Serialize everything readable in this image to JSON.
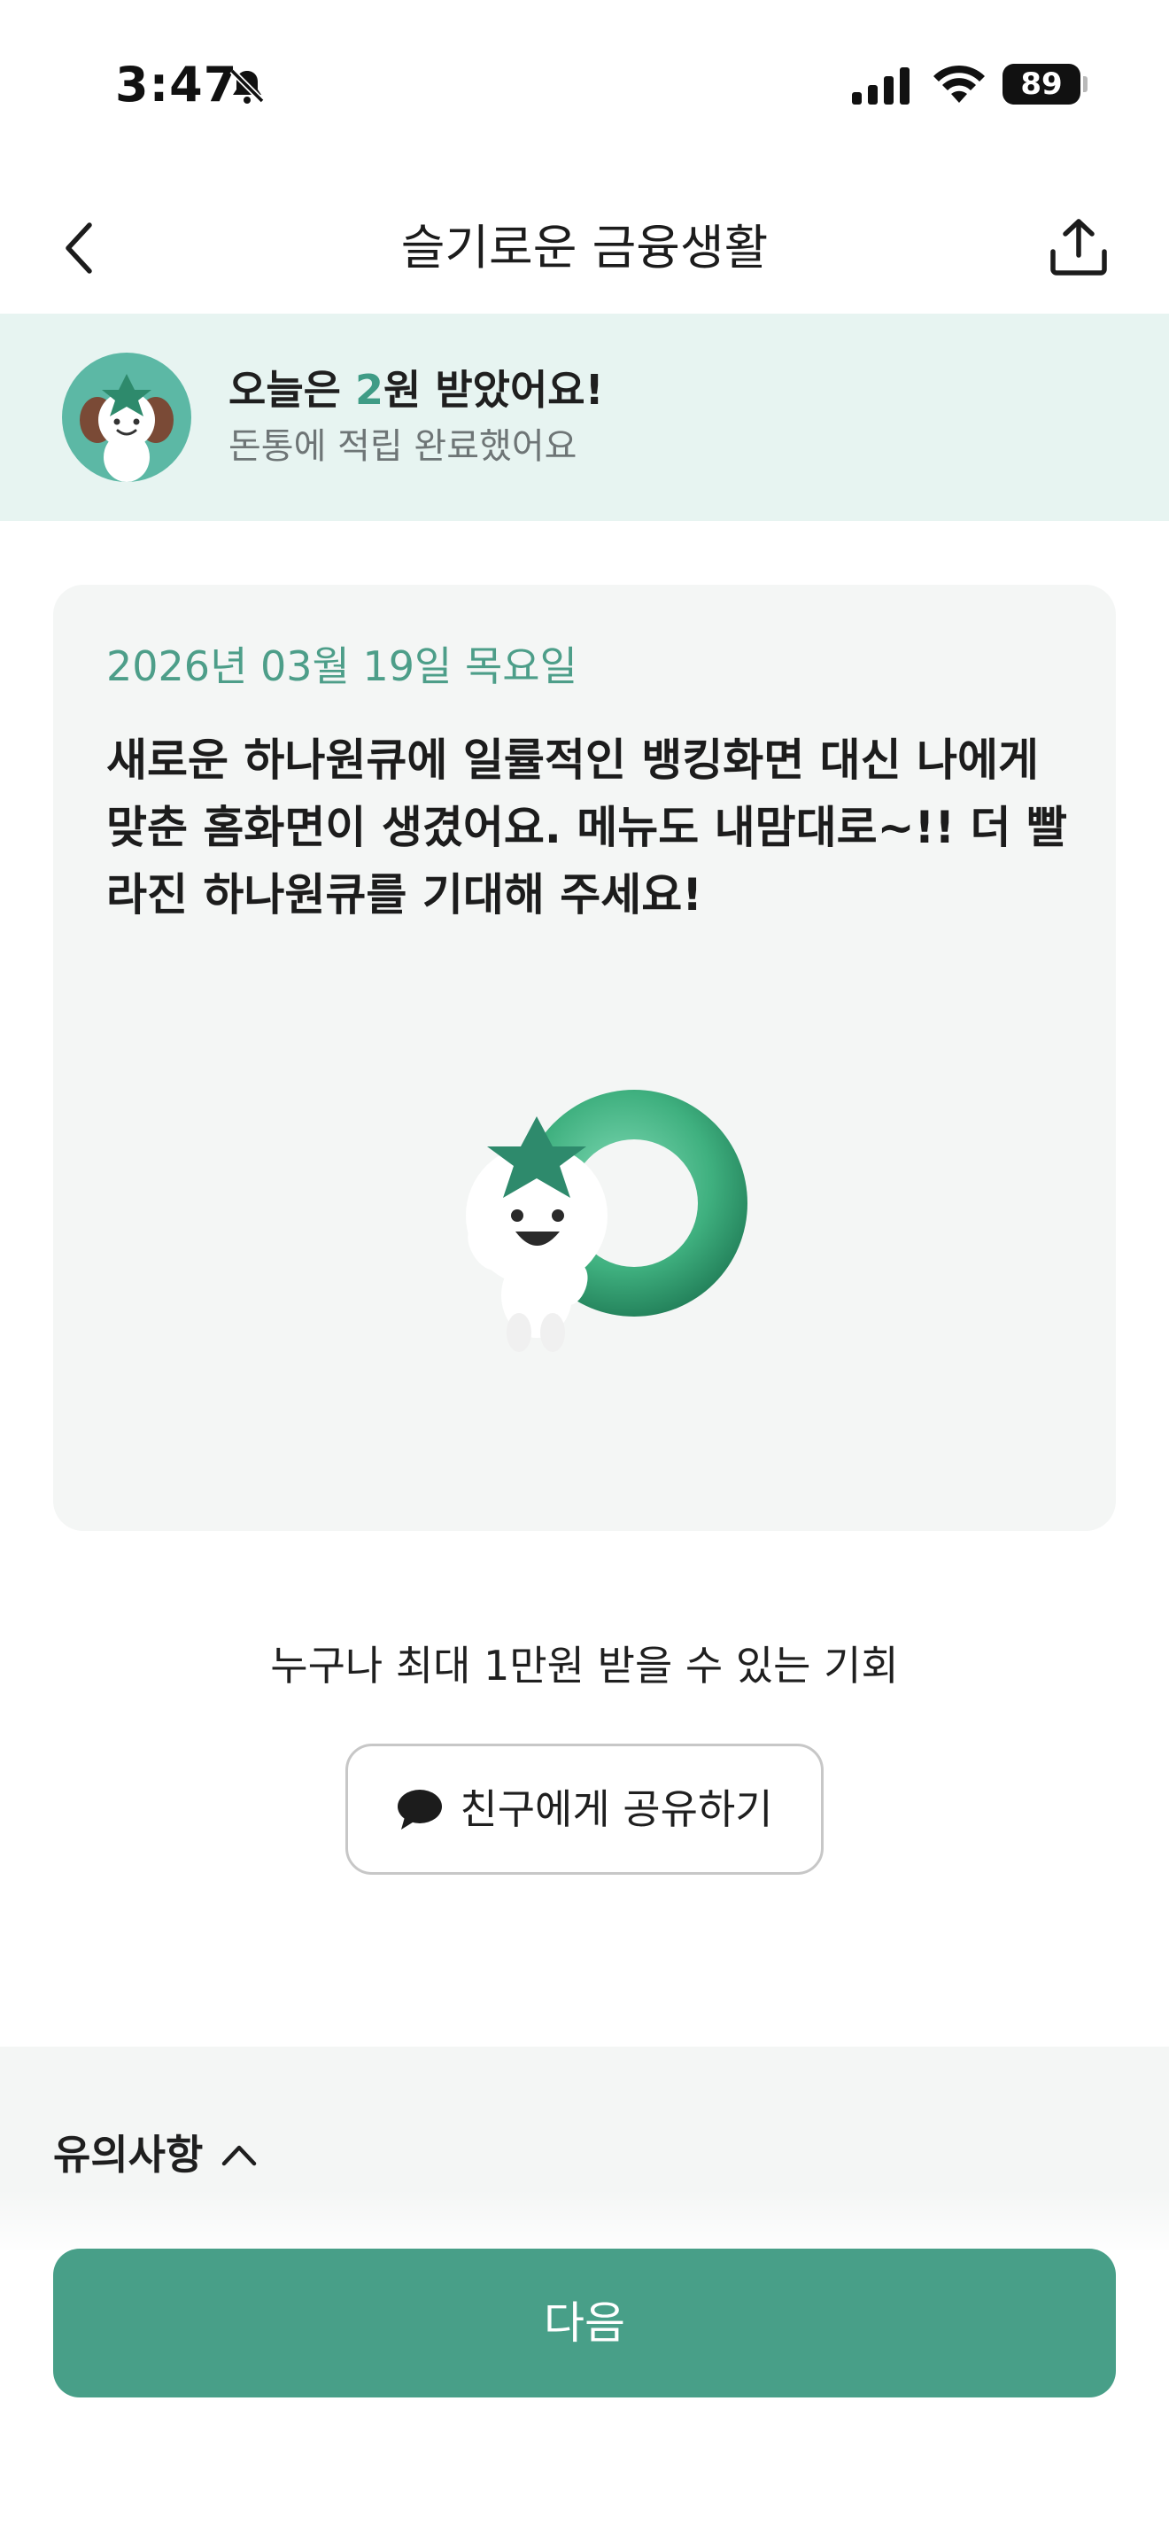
{
  "status_bar": {
    "time": "3:47",
    "battery": "89",
    "icons": [
      "bell-off-icon",
      "signal-icon",
      "wifi-icon",
      "battery-icon"
    ]
  },
  "header": {
    "title": "슬기로운 금융생활",
    "back_icon": "chevron-left-icon",
    "share_icon": "share-upload-icon"
  },
  "reward": {
    "title_prefix": "오늘은 ",
    "amount": "2",
    "title_suffix": "원 받았어요!",
    "subtitle": "돈통에 적립 완료했어요"
  },
  "story": {
    "date": "2026년 03월 19일 목요일",
    "text": "새로운 하나원큐에 일률적인 뱅킹화면 대신 나에게 맞춘 홈화면이 생겼어요. 메뉴도 내맘대로~!! 더 빨라진 하나원큐를 기대해 주세요!"
  },
  "promo": {
    "text": "누구나 최대 1만원 받을 수 있는 기회",
    "share_button_label": "친구에게 공유하기",
    "share_button_icon": "chat-bubble-icon"
  },
  "notice": {
    "label": "유의사항",
    "toggle_icon": "chevron-up-icon"
  },
  "footer": {
    "next_label": "다음"
  },
  "colors": {
    "accent": "#489f88",
    "banner_bg": "#e7f4f1",
    "card_bg": "#f4f6f5",
    "date_text": "#4d9e89"
  }
}
